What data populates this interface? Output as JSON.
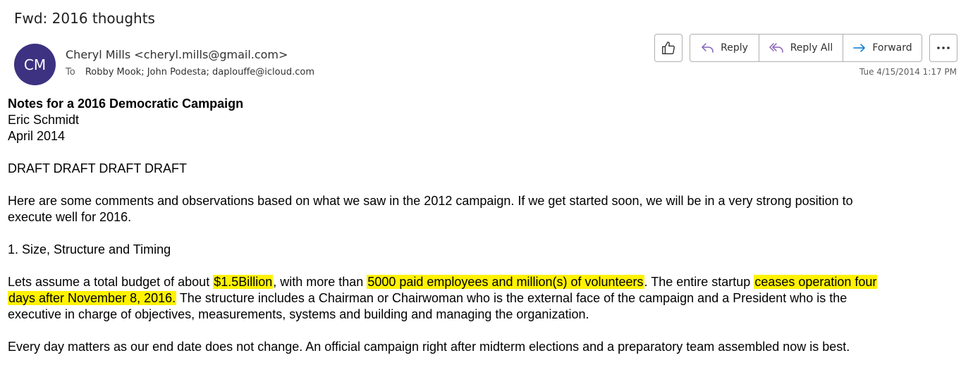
{
  "email": {
    "subject": "Fwd: 2016 thoughts",
    "avatar_initials": "CM",
    "sender": "Cheryl Mills <cheryl.mills@gmail.com>",
    "to_label": "To",
    "recipients": "Robby Mook; John Podesta; daplouffe@icloud.com",
    "timestamp": "Tue 4/15/2014 1:17 PM"
  },
  "toolbar": {
    "like_icon": "thumbs-up-icon",
    "reply_label": "Reply",
    "reply_all_label": "Reply All",
    "forward_label": "Forward",
    "more_icon": "more-horizontal-icon"
  },
  "body": {
    "title": "Notes for a 2016 Democratic Campaign",
    "author": "Eric Schmidt",
    "date": "April 2014",
    "draft": "DRAFT DRAFT DRAFT DRAFT",
    "intro_1": "Here are some comments and observations based on what we saw in the 2012 campaign.  If we get started soon, we will be in a very strong position to",
    "intro_2": "execute well for 2016.",
    "section_1": "1. Size, Structure and Timing",
    "p1_a": "Lets assume a total budget of about ",
    "p1_hl1": "$1.5Billion",
    "p1_b": ", with more than ",
    "p1_hl2": "5000 paid employees and million(s) of volunteers",
    "p1_c": ".  The entire startup ",
    "p1_hl3": "ceases operation four",
    "p1_hl4": "days after November 8, 2016.",
    "p1_d": "  The structure includes a Chairman or Chairwoman who is the external face of the campaign and a President who is the",
    "p1_e": "executive in charge of objectives, measurements, systems and building and managing the organization.",
    "p2": "Every day matters as our end date does not change.  An official campaign right after midterm elections and a preparatory team assembled now is best."
  },
  "colors": {
    "avatar_bg": "#3c3281",
    "reply_icon": "#8764b8",
    "forward_icon": "#0078d4",
    "highlight": "#fff200"
  }
}
